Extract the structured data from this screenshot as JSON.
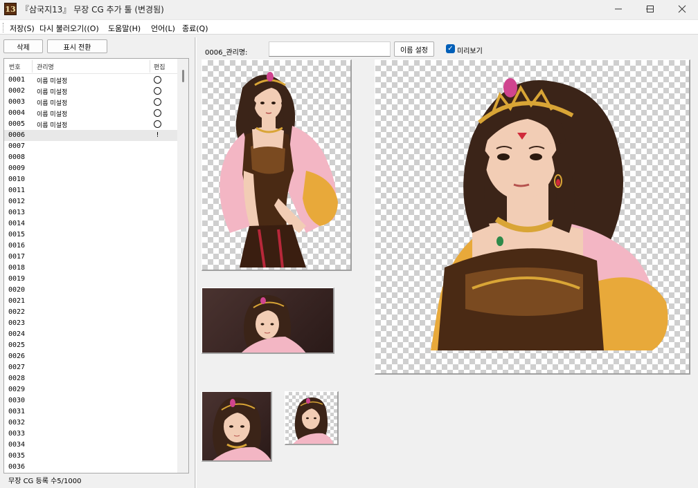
{
  "window": {
    "icon_text": "13",
    "title": "『삼국지13』 무장 CG 추가 툴 (변경됨)"
  },
  "menu": {
    "items": [
      "저장(S)",
      "다시 불러오기((O)",
      "도움말(H)",
      "언어(L)",
      "종료(Q)"
    ]
  },
  "toolbar": {
    "delete_label": "삭제",
    "toggle_view_label": "표시 전환"
  },
  "list": {
    "headers": {
      "number": "번호",
      "name": "관리명",
      "edit": "편집"
    },
    "selected_index": 5,
    "rows": [
      {
        "num": "0001",
        "name": "이름 미설정",
        "status": "circle"
      },
      {
        "num": "0002",
        "name": "이름 미설정",
        "status": "circle"
      },
      {
        "num": "0003",
        "name": "이름 미설정",
        "status": "circle"
      },
      {
        "num": "0004",
        "name": "이름 미설정",
        "status": "circle"
      },
      {
        "num": "0005",
        "name": "이름 미설정",
        "status": "circle"
      },
      {
        "num": "0006",
        "name": "",
        "status": "!"
      },
      {
        "num": "0007",
        "name": "",
        "status": ""
      },
      {
        "num": "0008",
        "name": "",
        "status": ""
      },
      {
        "num": "0009",
        "name": "",
        "status": ""
      },
      {
        "num": "0010",
        "name": "",
        "status": ""
      },
      {
        "num": "0011",
        "name": "",
        "status": ""
      },
      {
        "num": "0012",
        "name": "",
        "status": ""
      },
      {
        "num": "0013",
        "name": "",
        "status": ""
      },
      {
        "num": "0014",
        "name": "",
        "status": ""
      },
      {
        "num": "0015",
        "name": "",
        "status": ""
      },
      {
        "num": "0016",
        "name": "",
        "status": ""
      },
      {
        "num": "0017",
        "name": "",
        "status": ""
      },
      {
        "num": "0018",
        "name": "",
        "status": ""
      },
      {
        "num": "0019",
        "name": "",
        "status": ""
      },
      {
        "num": "0020",
        "name": "",
        "status": ""
      },
      {
        "num": "0021",
        "name": "",
        "status": ""
      },
      {
        "num": "0022",
        "name": "",
        "status": ""
      },
      {
        "num": "0023",
        "name": "",
        "status": ""
      },
      {
        "num": "0024",
        "name": "",
        "status": ""
      },
      {
        "num": "0025",
        "name": "",
        "status": ""
      },
      {
        "num": "0026",
        "name": "",
        "status": ""
      },
      {
        "num": "0027",
        "name": "",
        "status": ""
      },
      {
        "num": "0028",
        "name": "",
        "status": ""
      },
      {
        "num": "0029",
        "name": "",
        "status": ""
      },
      {
        "num": "0030",
        "name": "",
        "status": ""
      },
      {
        "num": "0031",
        "name": "",
        "status": ""
      },
      {
        "num": "0032",
        "name": "",
        "status": ""
      },
      {
        "num": "0033",
        "name": "",
        "status": ""
      },
      {
        "num": "0034",
        "name": "",
        "status": ""
      },
      {
        "num": "0035",
        "name": "",
        "status": ""
      },
      {
        "num": "0036",
        "name": "",
        "status": ""
      }
    ]
  },
  "status_bar": {
    "text": "무장 CG 등록 수5/1000"
  },
  "editor": {
    "name_label": "0006_관리명:",
    "name_value": "",
    "set_name_label": "이름 설정",
    "preview_checked": true,
    "preview_label": "미리보기"
  },
  "colors": {
    "accent": "#005fb8",
    "hair": "#3b2418",
    "skin": "#f2cdb5",
    "gold": "#d9a536",
    "armor": "#4a2a14",
    "pink_cape": "#f3b6c4",
    "fur": "#e8a93a",
    "gem": "#d0458f"
  }
}
